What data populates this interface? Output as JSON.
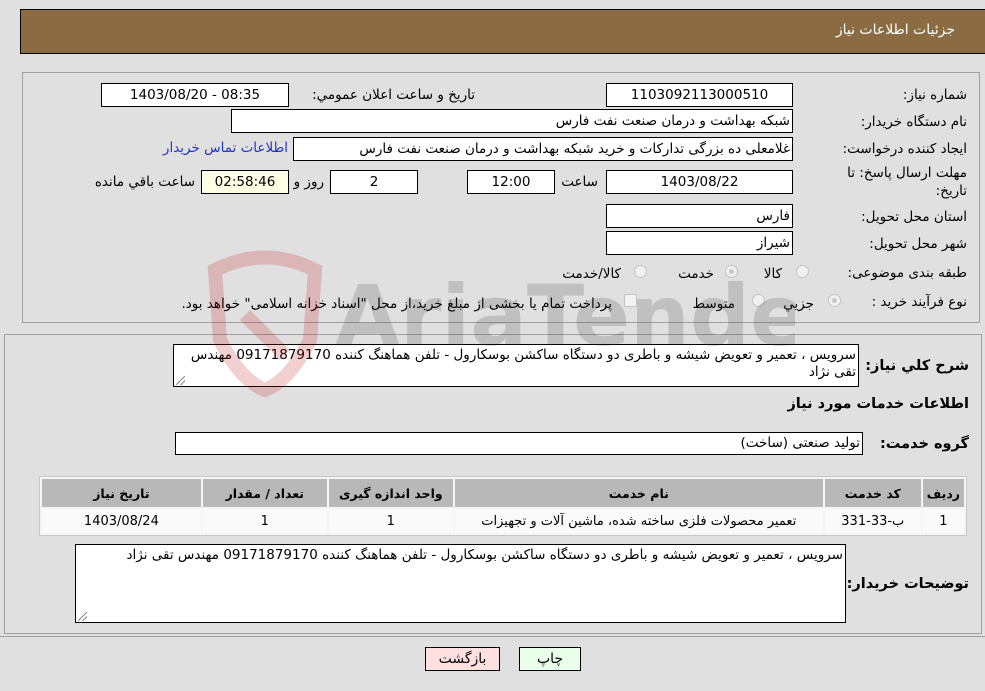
{
  "header": {
    "title": "جزئیات اطلاعات نیاز"
  },
  "form": {
    "need_number": {
      "label": "شماره نیاز:",
      "value": "1103092113000510"
    },
    "announce_datetime": {
      "label": "تاریخ و ساعت اعلان عمومي:",
      "value": "1403/08/20 - 08:35"
    },
    "buyer_org": {
      "label": "نام دستگاه خریدار:",
      "value": "شبکه بهداشت و درمان صنعت نفت فارس"
    },
    "requester": {
      "label": "ایجاد کننده درخواست:",
      "value": "غلامعلی ده بزرگی تدارکات و خرید شبکه بهداشت و درمان صنعت نفت فارس"
    },
    "buyer_contact_link": "اطلاعات تماس خریدار",
    "deadline": {
      "label": "مهلت ارسال پاسخ: تا تاریخ:",
      "date": "1403/08/22",
      "time_label": "ساعت",
      "time": "12:00",
      "days": "2",
      "days_label": "روز و",
      "remaining": "02:58:46",
      "remaining_label": "ساعت باقي مانده"
    },
    "province": {
      "label": "استان محل تحویل:",
      "value": "فارس"
    },
    "city": {
      "label": "شهر محل تحویل:",
      "value": "شیراز"
    },
    "category": {
      "label": "طبقه بندی موضوعی:",
      "options": [
        "کالا",
        "خدمت",
        "کالا/خدمت"
      ],
      "selected": "خدمت"
    },
    "purchase_type": {
      "label": "نوع فرآیند خرید :",
      "options": [
        "جزيي",
        "متوسط"
      ],
      "selected": "جزيي",
      "treasury_checkbox_label": "پرداخت تمام یا بخشی از مبلغ خرید،از محل \"اسناد خزانه اسلامی\" خواهد بود.",
      "treasury_checked": false
    }
  },
  "description": {
    "label": "شرح کلي نیاز:",
    "value": "سرویس ، تعمیر و تعویض شیشه و باطری دو دستگاه ساکشن بوسکارول - تلفن هماهنگ کننده 09171879170 مهندس تقی نژاد"
  },
  "services_section": {
    "title": "اطلاعات خدمات مورد نیاز",
    "service_group": {
      "label": "گروه خدمت:",
      "value": "تولید صنعتی (ساخت)"
    },
    "table": {
      "columns": [
        "ردیف",
        "کد خدمت",
        "نام خدمت",
        "واحد اندازه گیری",
        "تعداد / مقدار",
        "تاریخ نیاز"
      ],
      "rows": [
        [
          "1",
          "ب-33-331",
          "تعمیر محصولات فلزی ساخته شده، ماشین آلات و تجهیزات",
          "1",
          "1",
          "1403/08/24"
        ]
      ]
    }
  },
  "buyer_notes": {
    "label": "توضیحات خریدار:",
    "value": "سرویس ، تعمیر و تعویض شیشه و باطری دو دستگاه ساکشن بوسکارول - تلفن هماهنگ کننده 09171879170 مهندس تقی نژاد"
  },
  "buttons": {
    "print": "چاپ",
    "back": "بازگشت"
  },
  "watermark": {
    "text": "AriaTender.neT"
  },
  "colors": {
    "header_bg": "#8b6c42",
    "page_bg": "#e0e0e0",
    "link": "#2233cc",
    "print_btn_bg": "#eaffea",
    "back_btn_bg": "#ffe0e0",
    "remaining_bg": "#ffffe6",
    "table_header_bg": "#b8b8b8"
  }
}
